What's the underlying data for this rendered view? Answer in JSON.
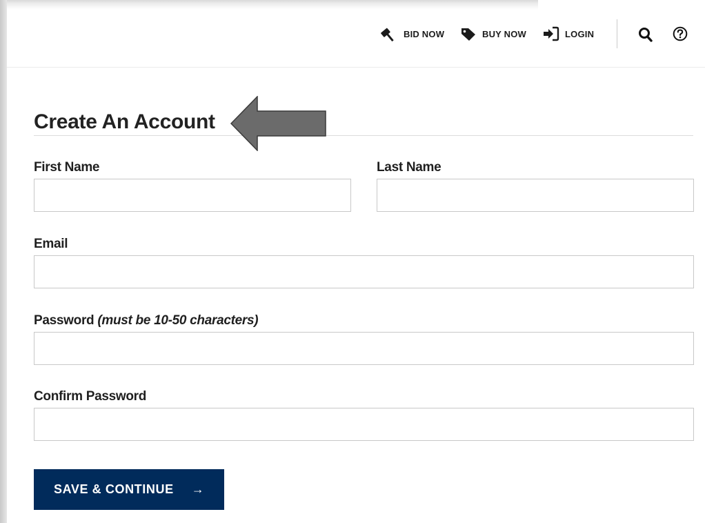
{
  "header": {
    "nav": [
      {
        "label": "BID NOW",
        "icon": "gavel-icon"
      },
      {
        "label": "BUY NOW",
        "icon": "tag-icon"
      },
      {
        "label": "LOGIN",
        "icon": "sign-in-icon"
      }
    ],
    "search_icon": "search-icon",
    "help_icon": "help-icon"
  },
  "form": {
    "title": "Create An Account",
    "first_name": {
      "label": "First Name",
      "value": ""
    },
    "last_name": {
      "label": "Last Name",
      "value": ""
    },
    "email": {
      "label": "Email",
      "value": ""
    },
    "password": {
      "label": "Password",
      "hint": "(must be 10-50 characters)",
      "value": ""
    },
    "confirm_password": {
      "label": "Confirm Password",
      "value": ""
    },
    "submit_label": "SAVE & CONTINUE",
    "submit_arrow": "→"
  },
  "colors": {
    "button_bg": "#012b5b",
    "callout_arrow": "#6b6b6b"
  }
}
